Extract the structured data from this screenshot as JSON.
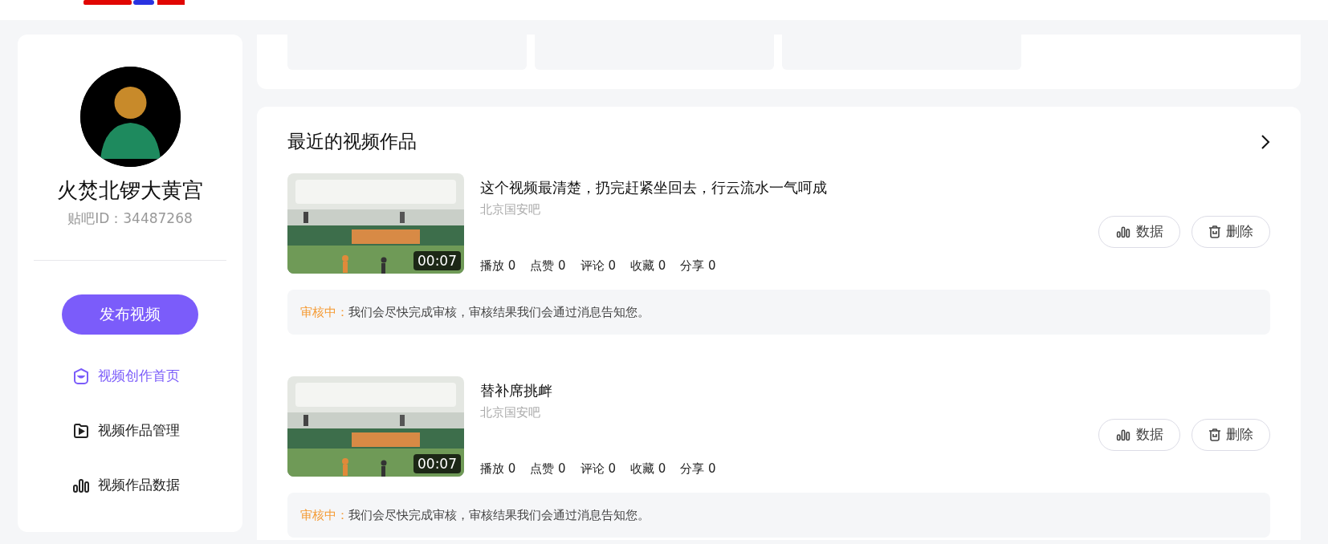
{
  "sidebar": {
    "user_name": "火焚北锣大黄宫",
    "user_id": "贴吧ID：34487268",
    "publish_button": "发布视频",
    "nav": [
      {
        "label": "视频创作首页",
        "kind": "home",
        "selected": true
      },
      {
        "label": "视频作品管理",
        "kind": "manage",
        "selected": false
      },
      {
        "label": "视频作品数据",
        "kind": "data",
        "selected": false
      }
    ]
  },
  "recent_videos": {
    "title": "最近的视频作品",
    "items": [
      {
        "duration": "00:07",
        "title": "这个视频最清楚，扔完赶紧坐回去，行云流水一气呵成",
        "forum": "北京国安吧",
        "stats": [
          "播放 0",
          "点赞 0",
          "评论 0",
          "收藏 0",
          "分享 0"
        ],
        "actions": [
          {
            "kind": "data",
            "label": "数据"
          },
          {
            "kind": "delete",
            "label": "删除"
          }
        ],
        "review_label": "审核中：",
        "review_message": "我们会尽快完成审核，审核结果我们会通过消息告知您。"
      },
      {
        "duration": "00:07",
        "title": "替补席挑衅",
        "forum": "北京国安吧",
        "stats": [
          "播放 0",
          "点赞 0",
          "评论 0",
          "收藏 0",
          "分享 0"
        ],
        "actions": [
          {
            "kind": "data",
            "label": "数据"
          },
          {
            "kind": "delete",
            "label": "删除"
          }
        ],
        "review_label": "审核中：",
        "review_message": "我们会尽快完成审核，审核结果我们会通过消息告知您。"
      }
    ]
  }
}
